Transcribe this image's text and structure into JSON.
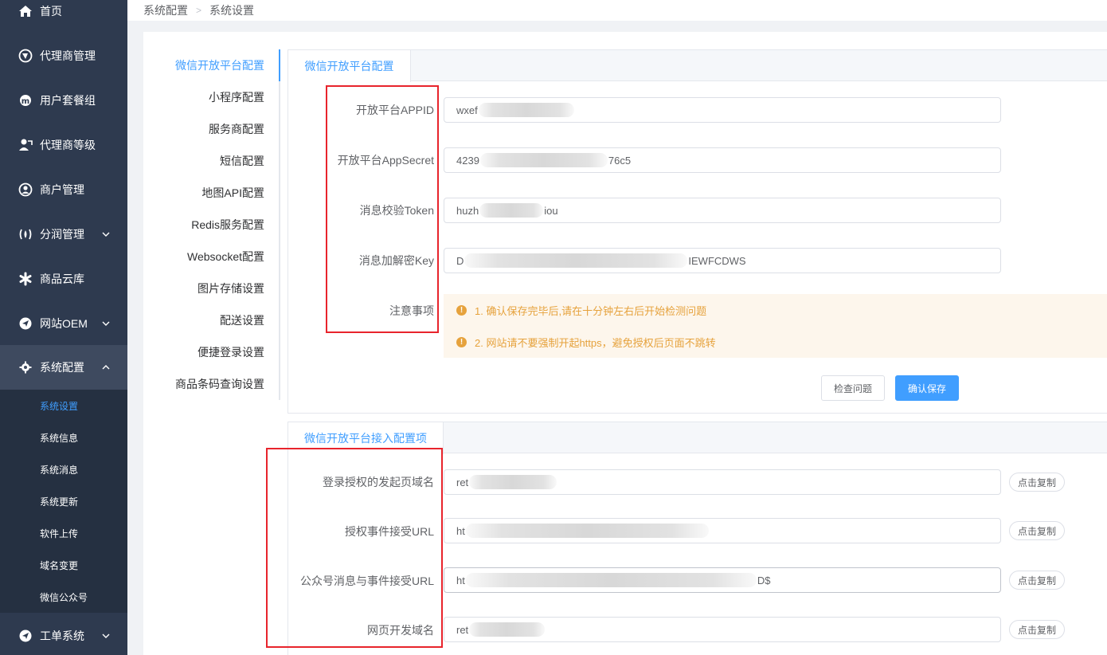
{
  "sidebar": {
    "menu": [
      {
        "label": "首页",
        "icon": "home-icon"
      },
      {
        "label": "代理商管理",
        "icon": "agent-icon"
      },
      {
        "label": "用户套餐组",
        "icon": "package-icon"
      },
      {
        "label": "代理商等级",
        "icon": "level-icon"
      },
      {
        "label": "商户管理",
        "icon": "user-icon"
      },
      {
        "label": "分润管理",
        "icon": "profit-icon"
      },
      {
        "label": "商品云库",
        "icon": "asterisk-icon"
      },
      {
        "label": "网站OEM",
        "icon": "send-icon"
      },
      {
        "label": "系统配置",
        "icon": "gear-icon"
      },
      {
        "label": "工单系统",
        "icon": "ticket-icon"
      }
    ],
    "submenu": [
      "系统设置",
      "系统信息",
      "系统消息",
      "系统更新",
      "软件上传",
      "域名变更",
      "微信公众号"
    ]
  },
  "breadcrumb": {
    "level1": "系统配置",
    "level2": "系统设置"
  },
  "tabs": [
    "微信开放平台配置",
    "小程序配置",
    "服务商配置",
    "短信配置",
    "地图API配置",
    "Redis服务配置",
    "Websocket配置",
    "图片存储设置",
    "配送设置",
    "便捷登录设置",
    "商品条码查询设置"
  ],
  "card1": {
    "tab": "微信开放平台配置",
    "rows": [
      {
        "label": "开放平台APPID",
        "value_prefix": "wxef",
        "value_suffix": ""
      },
      {
        "label": "开放平台AppSecret",
        "value_prefix": "4239",
        "value_suffix": "76c5"
      },
      {
        "label": "消息校验Token",
        "value_prefix": "huzh",
        "value_suffix": "iou"
      },
      {
        "label": "消息加解密Key",
        "value_prefix": "D",
        "value_suffix": "IEWFCDWS"
      }
    ],
    "notice_label": "注意事项",
    "notices": [
      "1. 确认保存完毕后,请在十分钟左右后开始检测问题",
      "2. 网站请不要强制开起https，避免授权后页面不跳转"
    ],
    "check_button": "检查问题",
    "save_button": "确认保存"
  },
  "card2": {
    "tab": "微信开放平台接入配置项",
    "rows": [
      {
        "label": "登录授权的发起页域名",
        "value_prefix": "ret",
        "value_suffix": ""
      },
      {
        "label": "授权事件接受URL",
        "value_prefix": "ht",
        "value_suffix": ""
      },
      {
        "label": "公众号消息与事件接受URL",
        "value_prefix": "ht",
        "value_suffix": "D$"
      },
      {
        "label": "网页开发域名",
        "value_prefix": "ret",
        "value_suffix": ""
      }
    ],
    "copy_label": "点击复制"
  },
  "colors": {
    "accent": "#409eff",
    "sidebar": "#2e3a4f",
    "warning": "#e6a23c",
    "highlight_box": "#e8242c"
  }
}
